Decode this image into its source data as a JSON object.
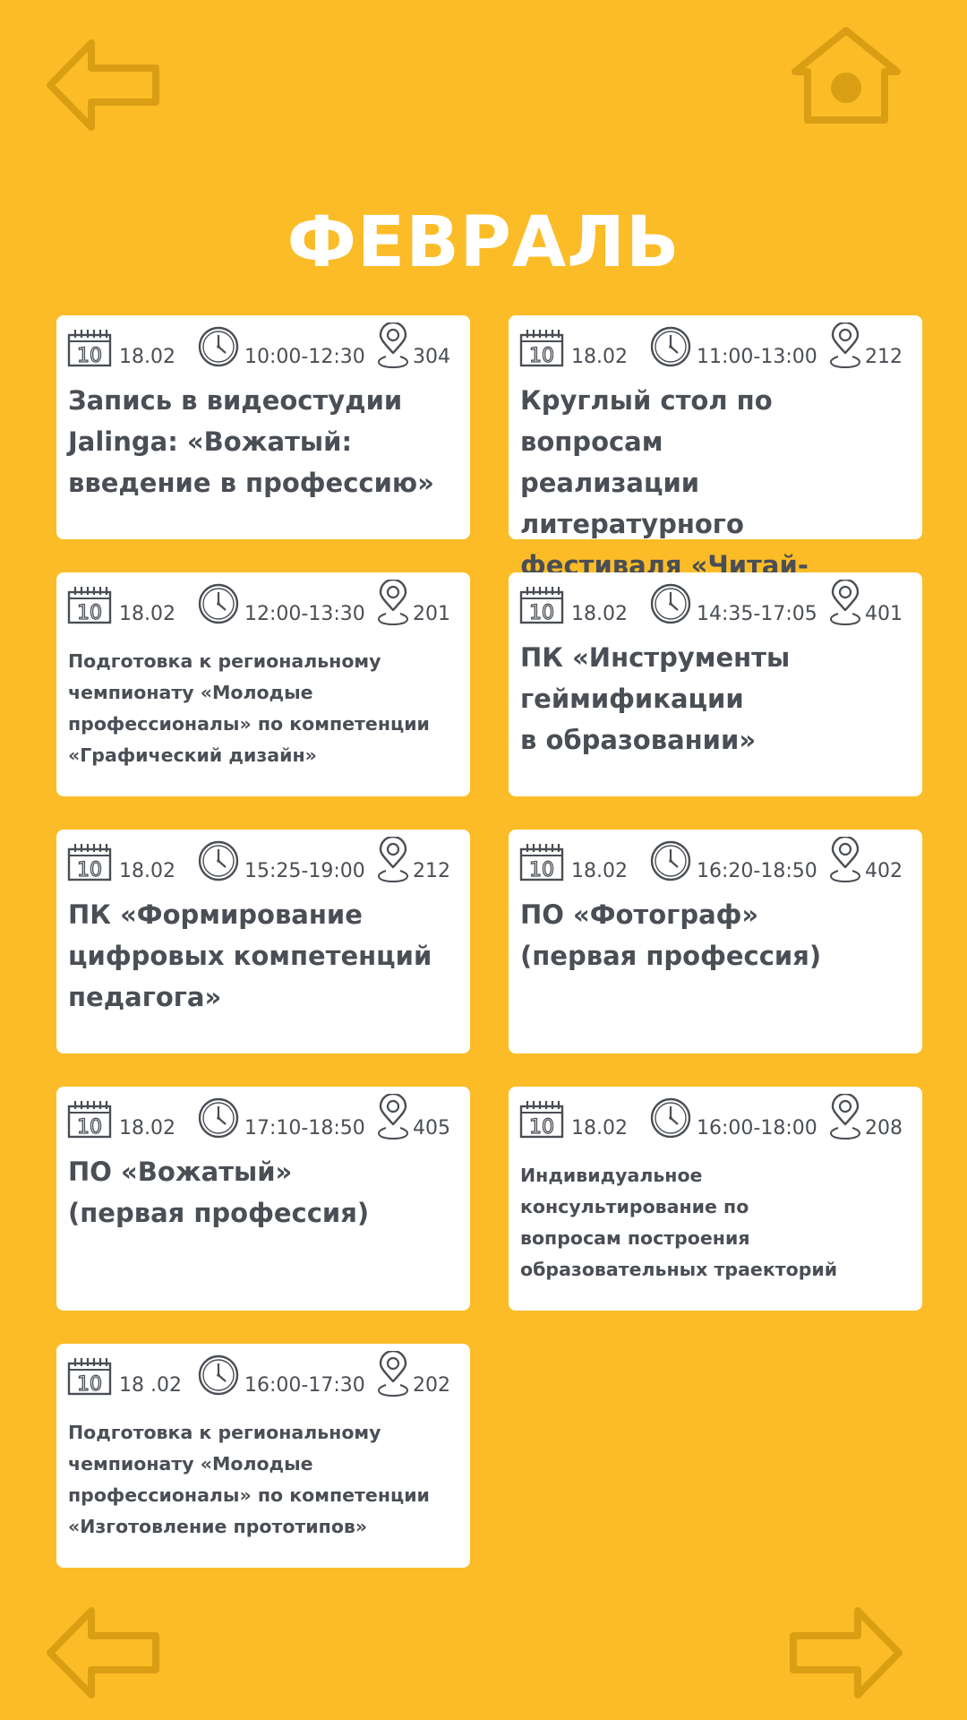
{
  "page": {
    "title": "ФЕВРАЛЬ"
  },
  "colors": {
    "background": "#FBBC27",
    "card": "#FFFFFF",
    "text": "#4A4E55",
    "nav_icon": "#D99E14"
  },
  "nav": {
    "back_icon": "arrow-left-icon",
    "home_icon": "home-icon",
    "forward_icon": "arrow-right-icon"
  },
  "events": [
    {
      "date": "18.02",
      "time": "10:00-12:30",
      "room": "304",
      "title": "Запись в видеостудии\nJalinga: «Вожатый:\nвведение в профессию»",
      "size": "big"
    },
    {
      "date": "18.02",
      "time": "11:00-13:00",
      "room": "212",
      "title": "Круглый стол по вопросам\nреализации литературного\nфестиваля «Читай-болтай»",
      "size": "big"
    },
    {
      "date": "18.02",
      "time": "12:00-13:30",
      "room": "201",
      "title": "Подготовка к региональному\nчемпионату «Молодые\nпрофессионалы» по компетенции\n«Графический дизайн»",
      "size": "small"
    },
    {
      "date": "18.02",
      "time": "14:35-17:05",
      "room": "401",
      "title": "ПК «Инструменты\nгеймификации\nв образовании»",
      "size": "big"
    },
    {
      "date": "18.02",
      "time": "15:25-19:00",
      "room": "212",
      "title": "ПК «Формирование\nцифровых компетенций\nпедагога»",
      "size": "big"
    },
    {
      "date": "18.02",
      "time": "16:20-18:50",
      "room": "402",
      "title": "ПО «Фотограф»\n(первая профессия)",
      "size": "big"
    },
    {
      "date": "18.02",
      "time": "17:10-18:50",
      "room": "405",
      "title": "ПО «Вожатый»\n(первая профессия)",
      "size": "big"
    },
    {
      "date": "18.02",
      "time": "16:00-18:00",
      "room": "208",
      "title": "Индивидуальное\nконсультирование по\nвопросам построения\nобразовательных траекторий",
      "size": "small"
    },
    {
      "date": "18 .02",
      "time": "16:00-17:30",
      "room": "202",
      "title": "Подготовка к региональному\nчемпионату «Молодые\nпрофессионалы» по компетенции\n«Изготовление прототипов»",
      "size": "small"
    }
  ],
  "icons": {
    "date": "calendar-icon",
    "time": "clock-icon",
    "room": "map-pin-icon"
  }
}
